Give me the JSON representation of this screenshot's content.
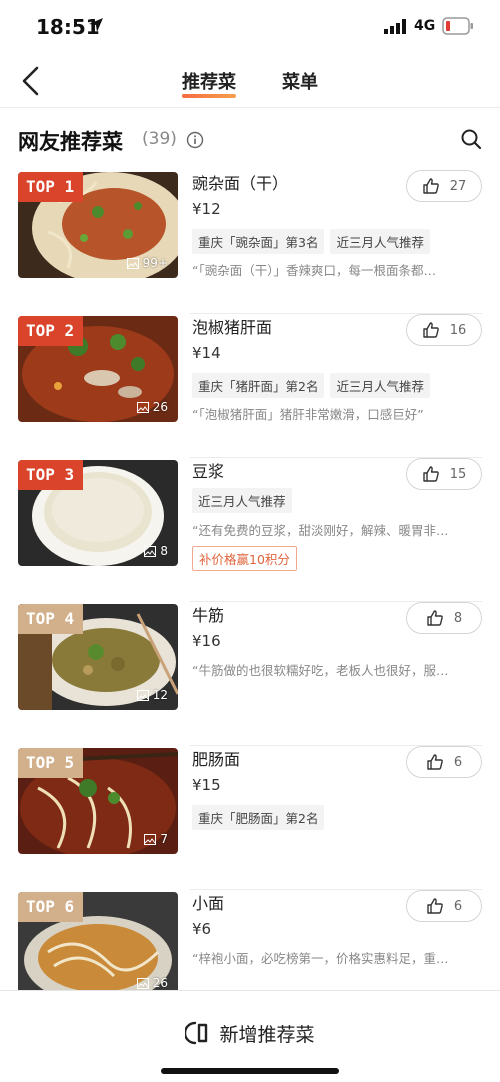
{
  "status": {
    "time": "18:51",
    "network": "4G"
  },
  "nav": {
    "tabs": [
      {
        "label": "推荐菜"
      },
      {
        "label": "菜单"
      }
    ]
  },
  "section": {
    "title": "网友推荐菜",
    "count": "(39)"
  },
  "dishes": [
    {
      "rank": "TOP 1",
      "name": "豌杂面（干）",
      "price": "¥12",
      "tags": [
        "重庆「豌杂面」第3名",
        "近三月人气推荐"
      ],
      "quote": "“「豌杂面（干）」香辣爽口，每一根面条都…",
      "photos": "99+",
      "likes": "27"
    },
    {
      "rank": "TOP 2",
      "name": "泡椒猪肝面",
      "price": "¥14",
      "tags": [
        "重庆「猪肝面」第2名",
        "近三月人气推荐"
      ],
      "quote": "“「泡椒猪肝面」猪肝非常嫩滑，口感巨好”",
      "photos": "26",
      "likes": "16"
    },
    {
      "rank": "TOP 3",
      "name": "豆浆",
      "price": "",
      "tags": [
        "近三月人气推荐"
      ],
      "quote": "“还有免费的豆浆，甜淡刚好，解辣、暖胃非…",
      "promo": "补价格赢10积分",
      "photos": "8",
      "likes": "15"
    },
    {
      "rank": "TOP 4",
      "name": "牛筋",
      "price": "¥16",
      "tags": [],
      "quote": "“牛筋做的也很软糯好吃，老板人也很好，服…",
      "photos": "12",
      "likes": "8"
    },
    {
      "rank": "TOP 5",
      "name": "肥肠面",
      "price": "¥15",
      "tags": [
        "重庆「肥肠面」第2名"
      ],
      "quote": "",
      "photos": "7",
      "likes": "6"
    },
    {
      "rank": "TOP 6",
      "name": "小面",
      "price": "¥6",
      "tags": [],
      "quote": "“梓袍小面，必吃榜第一，价格实惠料足，重…",
      "photos": "26",
      "likes": "6"
    }
  ],
  "bottom": {
    "add_label": "新增推荐菜"
  },
  "colors": {
    "accent": "#f56c42",
    "top_hot": "#d9442b",
    "top_warm": "#d2b08c"
  }
}
